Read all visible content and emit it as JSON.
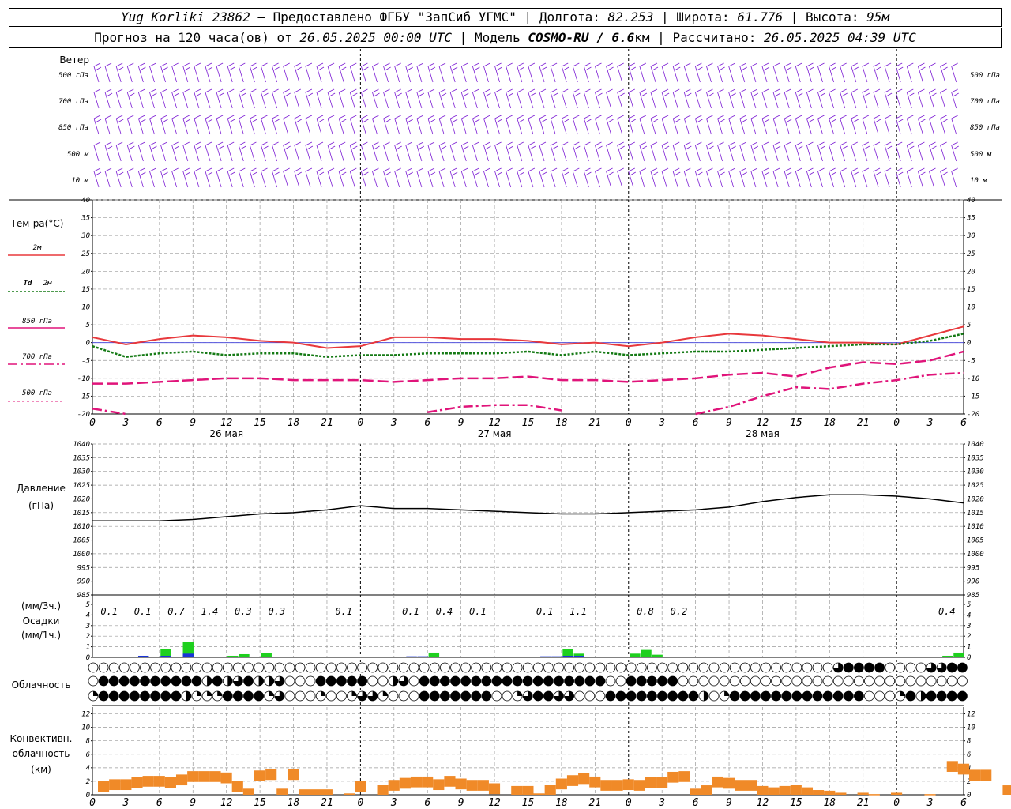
{
  "header": {
    "station": "Yug_Korliki_23862",
    "dash": "–",
    "provider": "Предоставлено ФГБУ \"ЗапСиб УГМС\"",
    "lon_label": "Долгота:",
    "lon": "82.253",
    "lat_label": "Широта:",
    "lat": "61.776",
    "alt_label": "Высота:",
    "alt": "95м",
    "forecast_label": "Прогноз на 120 часа(ов) от",
    "forecast_start": "26.05.2025 00:00 UTC",
    "model_label": "Модель",
    "model": "COSMO-RU / 6.6",
    "model_unit": "км",
    "calc_label": "Рассчитано:",
    "calc_time": "26.05.2025 04:39 UTC",
    "sep": "|"
  },
  "labels": {
    "wind": "Ветер",
    "wind_levels": [
      "500 гПа",
      "700 гПа",
      "850 гПа",
      "500 м",
      "10 м"
    ],
    "temp": "Тем-ра(°С)",
    "t2m": "2м",
    "td": "Td",
    "td2m": "2м",
    "t850": "850 гПа",
    "t700": "700 гПа",
    "t500": "500 гПа",
    "pressure": "Давление",
    "pressure_unit": "(гПа)",
    "precip_unit3": "(мм/3ч.)",
    "precip": "Осадки",
    "precip_unit1": "(мм/1ч.)",
    "cloud": "Облачность",
    "conv1": "Конвективн.",
    "conv2": "облачность",
    "conv3": "(км)"
  },
  "colors": {
    "t2m": "#e8383c",
    "td": "#157a15",
    "t850": "#e0147a",
    "t700": "#e0147a",
    "t500": "#e0147a",
    "wind": "#7c1dd4",
    "pressure": "#000000",
    "precip_blue": "#1a34d8",
    "precip_green": "#1ed01e",
    "conv": "#f08a28",
    "zero_line": "#3a3ad8"
  },
  "chart_data": [
    {
      "type": "line",
      "panel": "temperature",
      "x_hours_utc": [
        0,
        3,
        6,
        9,
        12,
        15,
        18,
        21,
        24,
        27,
        30,
        33,
        36,
        39,
        42,
        45,
        48,
        51,
        54,
        57,
        60,
        63,
        66,
        69,
        72,
        75,
        78
      ],
      "x_tick_labels": [
        "0",
        "3",
        "6",
        "9",
        "12",
        "15",
        "18",
        "21",
        "0",
        "3",
        "6",
        "9",
        "12",
        "15",
        "18",
        "21",
        "0",
        "3",
        "6",
        "9",
        "12",
        "15",
        "18",
        "21",
        "0",
        "3",
        "6"
      ],
      "day_labels": [
        "26 мая",
        "27 мая",
        "28 мая"
      ],
      "ylim": [
        -20,
        40
      ],
      "y_ticks": [
        "40",
        "35",
        "30",
        "25",
        "20",
        "15",
        "10",
        "5",
        "0",
        "-5",
        "-10",
        "-15",
        "-20"
      ],
      "series": [
        {
          "name": "2м",
          "values": [
            1.5,
            -0.5,
            1,
            2,
            1.5,
            0.5,
            0,
            -1.5,
            -1,
            1.5,
            1.5,
            1,
            1,
            0.5,
            -0.5,
            0,
            -1,
            0,
            1.5,
            2.5,
            2,
            1,
            0,
            0,
            -0.5,
            2,
            4.5
          ]
        },
        {
          "name": "Td 2м",
          "values": [
            -1,
            -4,
            -3,
            -2.5,
            -3.5,
            -3,
            -3,
            -4,
            -3.5,
            -3.5,
            -3,
            -3,
            -3,
            -2.5,
            -3.5,
            -2.5,
            -3.5,
            -3,
            -2.5,
            -2.5,
            -2,
            -1.5,
            -1,
            -0.5,
            -0.5,
            0.5,
            2.5
          ]
        },
        {
          "name": "850 гПа",
          "values": [
            -11.5,
            -11.5,
            -11,
            -10.5,
            -10,
            -10,
            -10.5,
            -10.5,
            -10.5,
            -11,
            -10.5,
            -10,
            -10,
            -9.5,
            -10.5,
            -10.5,
            -11,
            -10.5,
            -10,
            -9,
            -8.5,
            -9.5,
            -7,
            -5.5,
            -6,
            -5,
            -2.5
          ]
        },
        {
          "name": "700 гПа",
          "values": [
            -18.5,
            -20,
            null,
            null,
            null,
            null,
            null,
            null,
            null,
            null,
            -19.5,
            -18,
            -17.5,
            -17.5,
            -19,
            null,
            null,
            null,
            -20,
            -18,
            -15,
            -12.5,
            -13,
            -11.5,
            -10.5,
            -9,
            -8.5
          ]
        },
        {
          "name": "500 гПа",
          "values": []
        }
      ]
    },
    {
      "type": "line",
      "panel": "pressure",
      "x_hours_utc": [
        0,
        3,
        6,
        9,
        12,
        15,
        18,
        21,
        24,
        27,
        30,
        33,
        36,
        39,
        42,
        45,
        48,
        51,
        54,
        57,
        60,
        63,
        66,
        69,
        72,
        75,
        78
      ],
      "ylim": [
        985,
        1040
      ],
      "y_ticks": [
        "1040",
        "1035",
        "1030",
        "1025",
        "1020",
        "1015",
        "1010",
        "1005",
        "1000",
        "995",
        "990",
        "985"
      ],
      "series": [
        {
          "name": "Давление",
          "values": [
            1012,
            1012,
            1012,
            1012.5,
            1013.5,
            1014.5,
            1015,
            1016,
            1017.5,
            1016.5,
            1016.5,
            1016,
            1015.5,
            1015,
            1014.5,
            1014.5,
            1015,
            1015.5,
            1016,
            1017,
            1019,
            1020.5,
            1021.5,
            1021.5,
            1021,
            1020,
            1018.5
          ]
        }
      ]
    },
    {
      "type": "bar",
      "panel": "precipitation",
      "ylim": [
        0,
        5
      ],
      "y_ticks": [
        "5",
        "4",
        "3",
        "2",
        "1",
        "0"
      ],
      "totals_3h": [
        {
          "hour": 1.5,
          "label": "0.1"
        },
        {
          "hour": 4.5,
          "label": "0.1"
        },
        {
          "hour": 7.5,
          "label": "0.7"
        },
        {
          "hour": 10.5,
          "label": "1.4"
        },
        {
          "hour": 13.5,
          "label": "0.3"
        },
        {
          "hour": 16.5,
          "label": "0.3"
        },
        {
          "hour": 22.5,
          "label": "0.1"
        },
        {
          "hour": 28.5,
          "label": "0.1"
        },
        {
          "hour": 31.5,
          "label": "0.4"
        },
        {
          "hour": 34.5,
          "label": "0.1"
        },
        {
          "hour": 40.5,
          "label": "0.1"
        },
        {
          "hour": 43.5,
          "label": "1.1"
        },
        {
          "hour": 49.5,
          "label": "0.8"
        },
        {
          "hour": 52.5,
          "label": "0.2"
        },
        {
          "hour": 76.5,
          "label": "0.4"
        }
      ],
      "hourly": [
        {
          "hour": 1,
          "green": 0,
          "blue": 0.05
        },
        {
          "hour": 2,
          "green": 0,
          "blue": 0.05
        },
        {
          "hour": 4,
          "green": 0,
          "blue": 0.05
        },
        {
          "hour": 5,
          "green": 0,
          "blue": 0.15
        },
        {
          "hour": 7,
          "green": 0.75,
          "blue": 0.15
        },
        {
          "hour": 8,
          "green": 0.05,
          "blue": 0.05
        },
        {
          "hour": 9,
          "green": 1.45,
          "blue": 0.35
        },
        {
          "hour": 13,
          "green": 0.15,
          "blue": 0
        },
        {
          "hour": 14,
          "green": 0.3,
          "blue": 0
        },
        {
          "hour": 16,
          "green": 0.4,
          "blue": 0
        },
        {
          "hour": 22,
          "green": 0,
          "blue": 0.05
        },
        {
          "hour": 29,
          "green": 0,
          "blue": 0.1
        },
        {
          "hour": 30,
          "green": 0,
          "blue": 0.1
        },
        {
          "hour": 31,
          "green": 0.45,
          "blue": 0
        },
        {
          "hour": 34,
          "green": 0,
          "blue": 0.05
        },
        {
          "hour": 41,
          "green": 0,
          "blue": 0.1
        },
        {
          "hour": 42,
          "green": 0.05,
          "blue": 0.1
        },
        {
          "hour": 43,
          "green": 0.75,
          "blue": 0.15
        },
        {
          "hour": 44,
          "green": 0.35,
          "blue": 0.15
        },
        {
          "hour": 49,
          "green": 0.35,
          "blue": 0
        },
        {
          "hour": 50,
          "green": 0.7,
          "blue": 0
        },
        {
          "hour": 51,
          "green": 0.25,
          "blue": 0
        },
        {
          "hour": 76,
          "green": 0.05,
          "blue": 0
        },
        {
          "hour": 77,
          "green": 0.15,
          "blue": 0
        },
        {
          "hour": 78,
          "green": 0.45,
          "blue": 0
        }
      ]
    },
    {
      "type": "heatmap",
      "panel": "cloudiness",
      "rows": [
        "0000000000000000000000000000000000000000000000000000000000000000000000003444400003344",
        "0444444444424234223000444440023044444444444444444400444440000000000000000000000000000",
        "1444444442111444413000100133100044444440013443300044444444420144444444444440001424444"
      ]
    },
    {
      "type": "bar",
      "panel": "convective_cloud",
      "ylim": [
        0,
        13
      ],
      "y_ticks": [
        "12",
        "10",
        "8",
        "6",
        "4",
        "2",
        "0"
      ],
      "hourly_km": [
        2,
        2.3,
        2.3,
        2.6,
        2.8,
        2.8,
        2.6,
        3,
        3.5,
        3.5,
        3.5,
        3.3,
        2,
        0.9,
        3.6,
        3.8,
        0.9,
        3.8,
        0.8,
        0.8,
        0.8,
        0,
        0.2,
        2,
        0,
        1.5,
        2.2,
        2.5,
        2.7,
        2.7,
        2.3,
        2.8,
        2.4,
        2.2,
        2.2,
        1.7,
        0,
        1.3,
        1.3,
        0.2,
        1.5,
        2.4,
        2.9,
        3.2,
        2.7,
        2.2,
        2.2,
        2.3,
        2.2,
        2.6,
        2.6,
        3.4,
        3.5,
        0.9,
        1.4,
        2.7,
        2.5,
        2.2,
        2.2,
        1.3,
        1.1,
        1.3,
        1.5,
        1.1,
        0.7,
        0.6,
        0.3,
        0,
        0.3,
        0.1,
        0,
        0.3,
        0,
        0,
        0.1,
        0,
        5,
        4.6,
        3.7,
        3.7,
        0,
        1.4,
        0.6
      ]
    }
  ]
}
